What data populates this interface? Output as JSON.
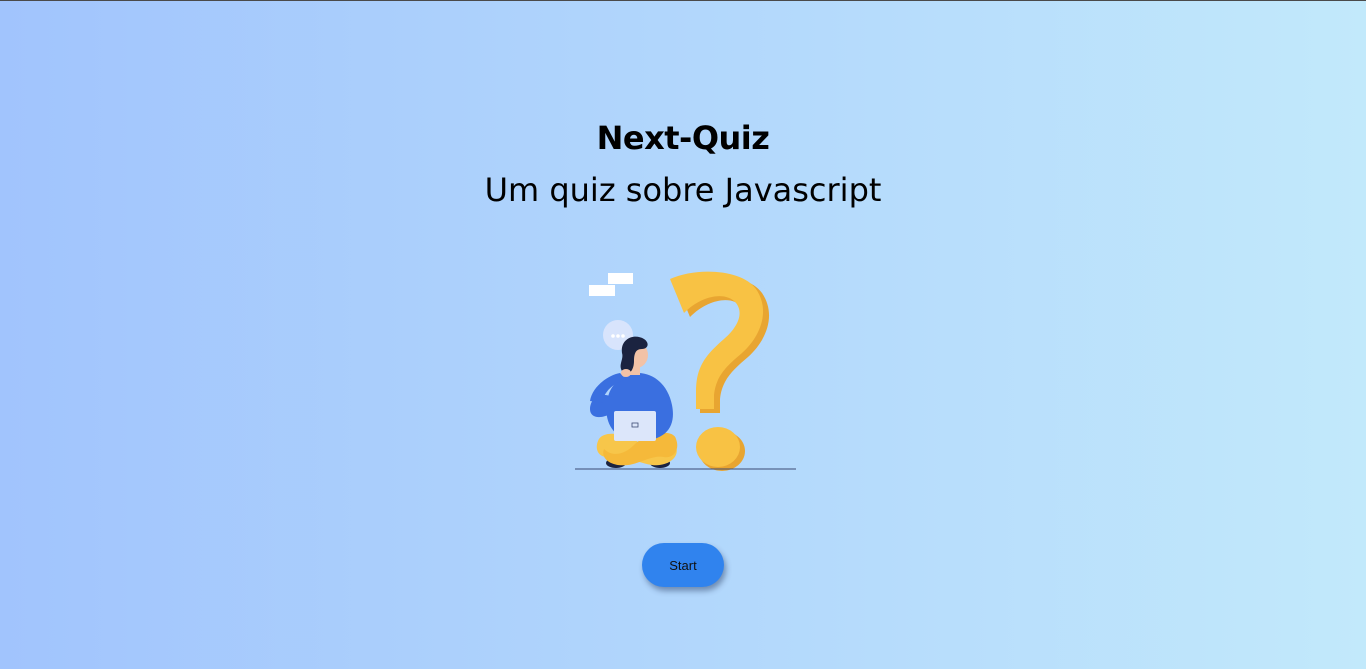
{
  "page": {
    "title": "Next-Quiz",
    "subtitle": "Um quiz sobre Javascript"
  },
  "illustration": {
    "icon": "question-mark-thinking-person-illustration",
    "colors": {
      "question_mark": "#f8c244",
      "question_mark_shadow": "#e8a531",
      "shirt": "#3a6fe0",
      "pants": "#f7c64a",
      "laptop": "#dce6fa",
      "hair": "#1b2340"
    }
  },
  "actions": {
    "start_label": "Start"
  },
  "theme": {
    "gradient_start": "#a1c4fd",
    "gradient_end": "#c2e9fb",
    "button_color": "#3083ee"
  }
}
